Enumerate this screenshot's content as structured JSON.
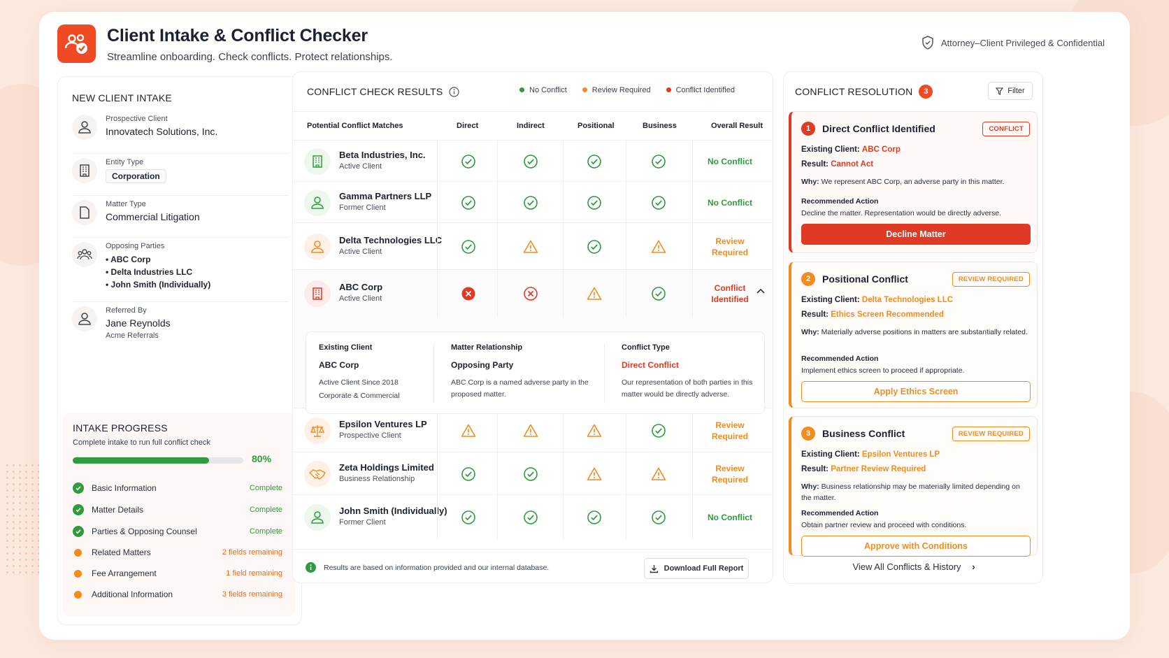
{
  "header": {
    "title": "Client Intake & Conflict Checker",
    "subtitle": "Streamline onboarding. Check conflicts. Protect relationships.",
    "privileged": "Attorney–Client Privileged & Confidential"
  },
  "intake": {
    "heading": "NEW CLIENT INTAKE",
    "prospective_label": "Prospective Client",
    "prospective_value": "Innovatech Solutions, Inc.",
    "entity_label": "Entity Type",
    "entity_value": "Corporation",
    "matter_label": "Matter Type",
    "matter_value": "Commercial Litigation",
    "opposing_label": "Opposing Parties",
    "opposing": [
      "• ABC Corp",
      "• Delta Industries LLC",
      "• John Smith (Individually)"
    ],
    "referred_label": "Referred By",
    "referred_value": "Jane Reynolds",
    "referred_org": "Acme Referrals"
  },
  "progress": {
    "heading": "INTAKE PROGRESS",
    "caption": "Complete intake to run full conflict check",
    "percent_label": "80%",
    "fraction": 0.8,
    "steps": [
      {
        "label": "Basic Information",
        "status": "Complete",
        "state": "ok"
      },
      {
        "label": "Matter Details",
        "status": "Complete",
        "state": "ok"
      },
      {
        "label": "Parties & Opposing Counsel",
        "status": "Complete",
        "state": "ok"
      },
      {
        "label": "Related Matters",
        "status": "2 fields remaining",
        "state": "pend"
      },
      {
        "label": "Fee Arrangement",
        "status": "1 field remaining",
        "state": "pend"
      },
      {
        "label": "Additional Information",
        "status": "3 fields remaining",
        "state": "pend"
      }
    ]
  },
  "results": {
    "heading": "CONFLICT CHECK RESULTS",
    "legend": [
      "No Conflict",
      "Review Required",
      "Conflict Identified"
    ],
    "columns": [
      "Potential Conflict Matches",
      "Direct",
      "Indirect",
      "Positional",
      "Business",
      "Overall Result"
    ],
    "rows": [
      {
        "name": "Beta Industries, Inc.",
        "sub": "Active Client",
        "icon": "building-icon",
        "tone": "g",
        "marks": [
          "ok",
          "ok",
          "ok",
          "ok"
        ],
        "result": "No Conflict"
      },
      {
        "name": "Gamma Partners LLP",
        "sub": "Former Client",
        "icon": "person-icon",
        "tone": "g",
        "marks": [
          "ok",
          "ok",
          "ok",
          "ok"
        ],
        "result": "No Conflict"
      },
      {
        "name": "Delta Technologies LLC",
        "sub": "Active Client",
        "icon": "person-icon",
        "tone": "o",
        "marks": [
          "ok",
          "warn",
          "ok",
          "warn"
        ],
        "result": "Review Required"
      },
      {
        "name": "ABC Corp",
        "sub": "Active Client",
        "icon": "building-icon",
        "tone": "r",
        "marks": [
          "xfill",
          "x",
          "warn",
          "ok"
        ],
        "result": "Conflict Identified"
      },
      {
        "name": "Epsilon Ventures LP",
        "sub": "Prospective Client",
        "icon": "scales-icon",
        "tone": "o",
        "marks": [
          "warn",
          "warn",
          "warn",
          "ok"
        ],
        "result": "Review Required"
      },
      {
        "name": "Zeta Holdings Limited",
        "sub": "Business Relationship",
        "icon": "handshake-icon",
        "tone": "o",
        "marks": [
          "ok",
          "ok",
          "warn",
          "warn"
        ],
        "result": "Review Required"
      },
      {
        "name": "John Smith (Individually)",
        "sub": "Former Client",
        "icon": "person-icon",
        "tone": "g",
        "marks": [
          "ok",
          "ok",
          "ok",
          "ok"
        ],
        "result": "No Conflict"
      }
    ],
    "detail": {
      "existing_h": "Existing Client",
      "existing_v": "ABC Corp",
      "existing_t1": "Active Client Since 2018",
      "existing_t2": "Corporate & Commercial",
      "matter_h": "Matter Relationship",
      "matter_v": "Opposing Party",
      "matter_t": "ABC Corp is a named adverse party in the proposed matter.",
      "type_h": "Conflict Type",
      "type_v": "Direct Conflict",
      "type_t": "Our representation of both parties in this matter would be directly adverse."
    },
    "footer_note": "Results are based on information provided and our internal database.",
    "download_label": "Download Full Report"
  },
  "resolution": {
    "heading": "CONFLICT RESOLUTION",
    "count": "3",
    "filter_label": "Filter",
    "cards": [
      {
        "num": "1",
        "title": "Direct Conflict Identified",
        "tag": "CONFLICT",
        "client": "ABC Corp",
        "result": "Cannot Act",
        "why": "We represent ABC Corp, an adverse party in this matter.",
        "action": "Decline the matter. Representation would be directly adverse.",
        "button": "Decline Matter"
      },
      {
        "num": "2",
        "title": "Positional Conflict",
        "tag": "REVIEW REQUIRED",
        "client": "Delta Technologies LLC",
        "result": "Ethics Screen Recommended",
        "why": "Materially adverse positions in matters are substantially related.",
        "action": "Implement ethics screen to proceed if appropriate.",
        "button": "Apply Ethics Screen"
      },
      {
        "num": "3",
        "title": "Business Conflict",
        "tag": "REVIEW REQUIRED",
        "client": "Epsilon Ventures LP",
        "result": "Partner Review Required",
        "why": "Business relationship may be materially limited depending on the matter.",
        "action": "Obtain partner review and proceed with conditions.",
        "button": "Approve with Conditions"
      }
    ],
    "labels": {
      "existing": "Existing Client:",
      "result": "Result:",
      "why": "Why:",
      "action": "Recommended Action"
    },
    "view_all": "View All Conflicts & History"
  },
  "colors": {
    "accent": "#ef4a23",
    "green": "#2e9b3e",
    "orange": "#f28c1f",
    "red": "#e03a24"
  }
}
